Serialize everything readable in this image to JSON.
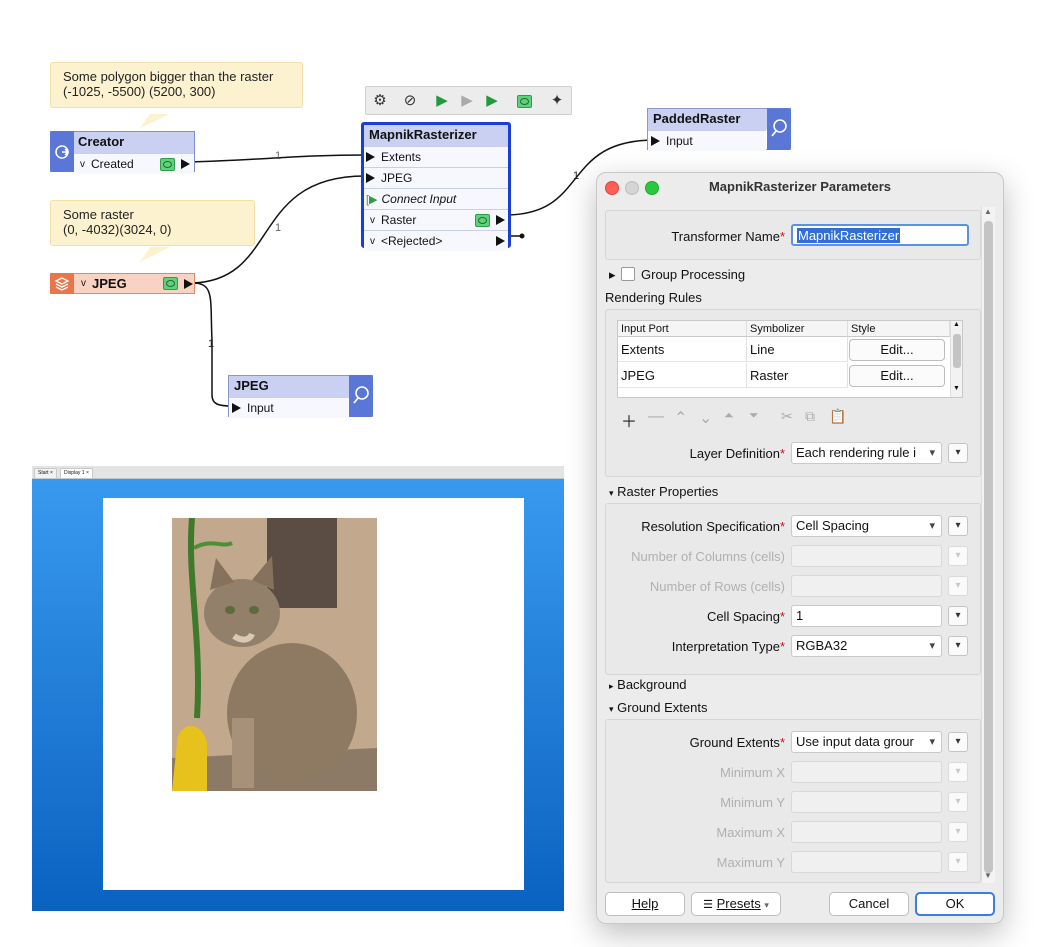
{
  "annotations": {
    "polygon": {
      "line1": "Some polygon bigger than the raster",
      "line2": "(-1025, -5500) (5200, 300)"
    },
    "raster": {
      "line1": "Some raster",
      "line2": "(0, -4032)(3024, 0)"
    }
  },
  "nodes": {
    "creator": {
      "title": "Creator",
      "port": "Created"
    },
    "jpeg_reader": {
      "title": "JPEG"
    },
    "mapnik": {
      "title": "MapnikRasterizer",
      "ports": [
        "Extents",
        "JPEG",
        "Connect Input",
        "Raster",
        "<Rejected>"
      ]
    },
    "padded": {
      "title": "PaddedRaster",
      "port": "Input"
    },
    "jpeg_inspector": {
      "title": "JPEG",
      "port": "Input"
    }
  },
  "connections": {
    "c1": "1",
    "c2": "1",
    "c3": "1",
    "c4": "1"
  },
  "preview": {
    "tab1": "Start",
    "tab2": "Display 1"
  },
  "dialog": {
    "title": "MapnikRasterizer Parameters",
    "transformer_name_label": "Transformer Name",
    "transformer_name_value": "MapnikRasterizer",
    "group_processing": "Group Processing",
    "rendering_rules": "Rendering Rules",
    "table": {
      "headers": [
        "Input Port",
        "Symbolizer",
        "Style"
      ],
      "rows": [
        {
          "port": "Extents",
          "symbolizer": "Line",
          "style": "Edit..."
        },
        {
          "port": "JPEG",
          "symbolizer": "Raster",
          "style": "Edit..."
        }
      ]
    },
    "layer_definition_label": "Layer Definition",
    "layer_definition_value": "Each rendering rule i",
    "raster_properties": "Raster Properties",
    "resolution_label": "Resolution Specification",
    "resolution_value": "Cell Spacing",
    "num_cols_label": "Number of Columns (cells)",
    "num_rows_label": "Number of Rows (cells)",
    "cell_spacing_label": "Cell Spacing",
    "cell_spacing_value": "1",
    "interp_label": "Interpretation Type",
    "interp_value": "RGBA32",
    "background": "Background",
    "ground_extents_section": "Ground Extents",
    "ground_extents_label": "Ground Extents",
    "ground_extents_value": "Use input data grour",
    "min_x": "Minimum X",
    "min_y": "Minimum Y",
    "max_x": "Maximum X",
    "max_y": "Maximum Y",
    "buttons": {
      "help": "Help",
      "presets": "Presets",
      "cancel": "Cancel",
      "ok": "OK"
    }
  }
}
